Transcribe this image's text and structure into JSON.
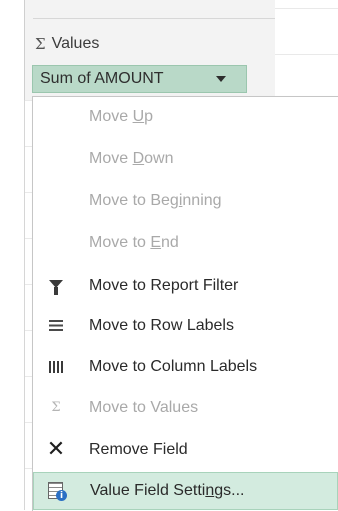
{
  "values_area": {
    "header_icon": "sigma-icon",
    "header_label": "Values",
    "field_label": "Sum of AMOUNT"
  },
  "menu": {
    "items": [
      {
        "pre": "Move ",
        "u": "U",
        "post": "p",
        "enabled": false,
        "icon": ""
      },
      {
        "pre": "Move ",
        "u": "D",
        "post": "own",
        "enabled": false,
        "icon": ""
      },
      {
        "pre": "Move to Beg",
        "u": "i",
        "post": "nning",
        "enabled": false,
        "icon": ""
      },
      {
        "pre": "Move to ",
        "u": "E",
        "post": "nd",
        "enabled": false,
        "icon": ""
      },
      {
        "pre": "Move to Report Filter",
        "u": "",
        "post": "",
        "enabled": true,
        "icon": "filter-funnel-icon"
      },
      {
        "pre": "Move to Row Labels",
        "u": "",
        "post": "",
        "enabled": true,
        "icon": "row-labels-icon"
      },
      {
        "pre": "Move to Column Labels",
        "u": "",
        "post": "",
        "enabled": true,
        "icon": "column-labels-icon"
      },
      {
        "pre": "Move to Values",
        "u": "",
        "post": "",
        "enabled": false,
        "icon": "sigma-icon"
      },
      {
        "pre": "Remove Field",
        "u": "",
        "post": "",
        "enabled": true,
        "icon": "remove-x-icon"
      },
      {
        "pre": "Value Field Setti",
        "u": "n",
        "post": "gs...",
        "enabled": true,
        "icon": "value-field-settings-icon",
        "highlighted": true
      }
    ]
  },
  "colors": {
    "field_pill": "#b9d9c8",
    "highlight": "#d3ebdf",
    "disabled_text": "#a9a9a9"
  }
}
